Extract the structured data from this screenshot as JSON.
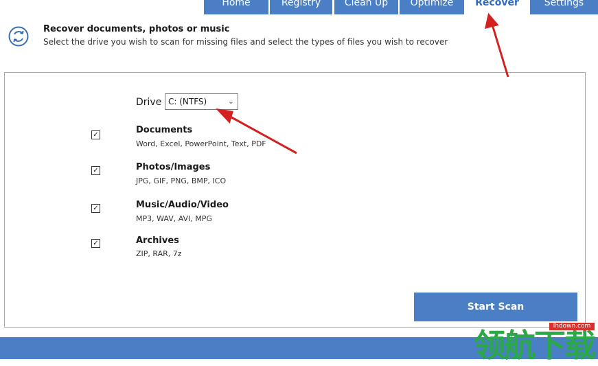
{
  "nav": {
    "tabs": [
      {
        "label": "Home"
      },
      {
        "label": "Registry"
      },
      {
        "label": "Clean Up"
      },
      {
        "label": "Optimize"
      },
      {
        "label": "Recover"
      },
      {
        "label": "Settings"
      }
    ],
    "active_tab": "Recover"
  },
  "header": {
    "icon": "recover-cycle-icon",
    "title": "Recover documents, photos or music",
    "subtitle": "Select the drive you wish to scan for missing files and select the types of files you wish to recover"
  },
  "drive": {
    "label": "Drive",
    "selected": "C: (NTFS)"
  },
  "file_types": [
    {
      "title": "Documents",
      "desc": "Word, Excel, PowerPoint, Text, PDF",
      "checked": true
    },
    {
      "title": "Photos/Images",
      "desc": "JPG, GIF, PNG, BMP, ICO",
      "checked": true
    },
    {
      "title": "Music/Audio/Video",
      "desc": "MP3, WAV, AVI, MPG",
      "checked": true
    },
    {
      "title": "Archives",
      "desc": "ZIP, RAR, 7z",
      "checked": true
    }
  ],
  "scan_button": "Start Scan",
  "watermark": {
    "text": "领航下载",
    "domain": "lhdown.com"
  },
  "colors": {
    "accent": "#4a7ec5",
    "active_tab_text": "#2b6cc4",
    "annotation_arrow": "#d42020"
  }
}
